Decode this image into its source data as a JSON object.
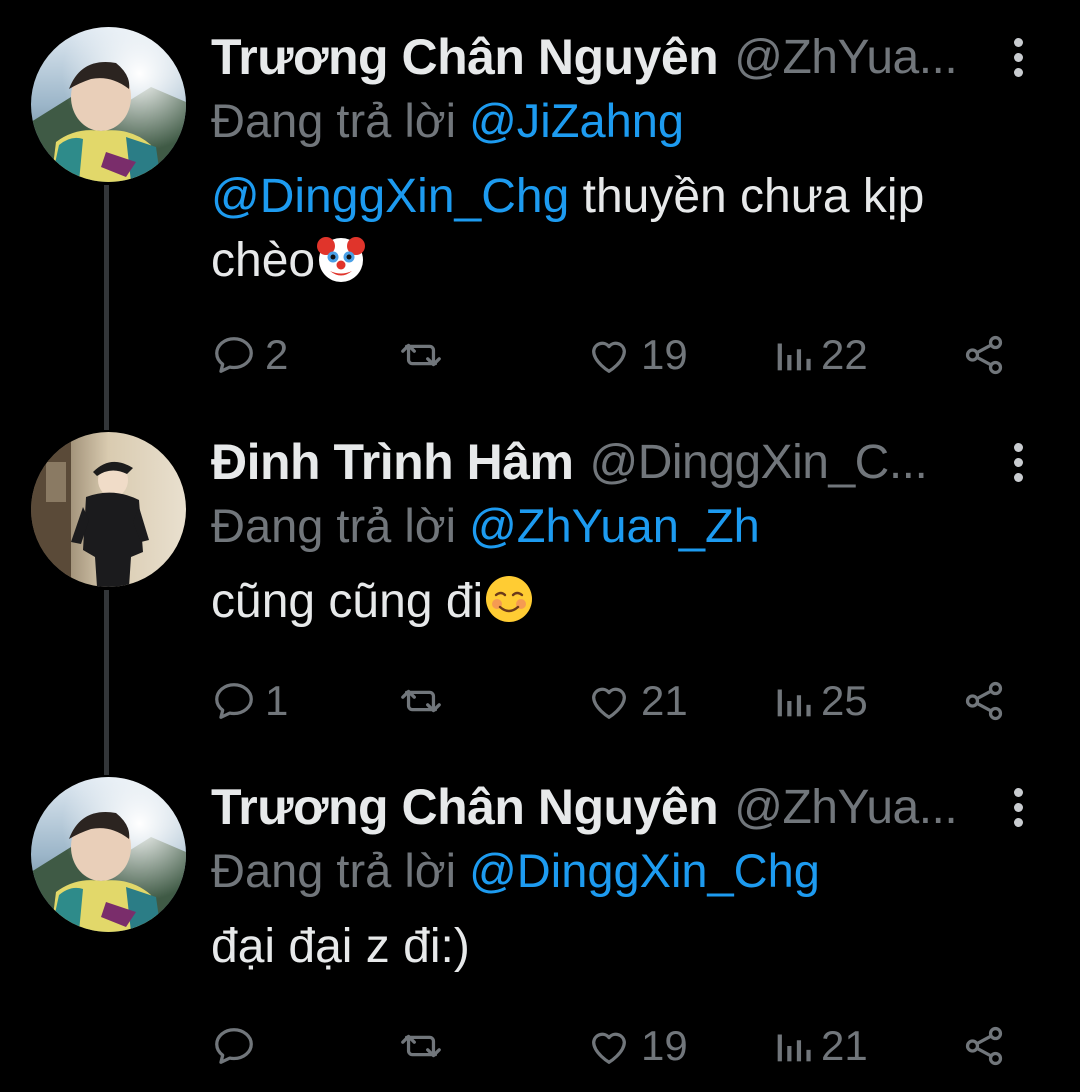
{
  "tweets": [
    {
      "name": "Trương Chân Nguyên",
      "handle": "@ZhYua...",
      "reply_prefix": "Đang trả lời",
      "reply_to": "@JiZahng",
      "mention": "@DinggXin_Chg",
      "text": " thuyền chưa kịp chèo",
      "emoji": "clown-face",
      "replies": "2",
      "retweets": "",
      "likes": "19",
      "views": "22"
    },
    {
      "name": "Đinh Trình Hâm",
      "handle": "@DinggXin_C...",
      "reply_prefix": "Đang trả lời",
      "reply_to": "@ZhYuan_Zh",
      "mention": "",
      "text": "cũng cũng đi",
      "emoji": "smiling-blush-face",
      "replies": "1",
      "retweets": "",
      "likes": "21",
      "views": "25"
    },
    {
      "name": "Trương Chân Nguyên",
      "handle": "@ZhYua...",
      "reply_prefix": "Đang trả lời",
      "reply_to": "@DinggXin_Chg",
      "mention": "",
      "text": "đại đại z đi:)",
      "emoji": "",
      "replies": "",
      "retweets": "",
      "likes": "19",
      "views": "21"
    }
  ],
  "colors": {
    "background": "#000000",
    "text": "#e7e9ea",
    "muted": "#71767b",
    "link": "#1d9bf0",
    "thread_line": "#333639"
  }
}
